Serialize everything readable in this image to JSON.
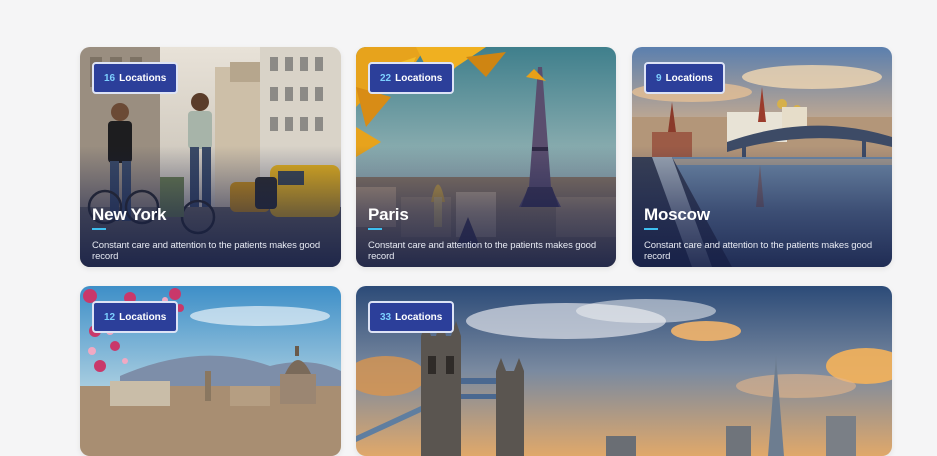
{
  "cards": [
    {
      "count": "16",
      "unit": "Locations",
      "city": "New York",
      "description": "Constant care and attention to the patients makes good record"
    },
    {
      "count": "22",
      "unit": "Locations",
      "city": "Paris",
      "description": "Constant care and attention to the patients makes good record"
    },
    {
      "count": "9",
      "unit": "Locations",
      "city": "Moscow",
      "description": "Constant care and attention to the patients makes good record"
    },
    {
      "count": "12",
      "unit": "Locations",
      "city": "",
      "description": ""
    },
    {
      "count": "33",
      "unit": "Locations",
      "city": "",
      "description": ""
    }
  ],
  "colors": {
    "badge_bg": "#2c3f9a",
    "badge_number": "#7dd0ff",
    "accent_underline": "#3ec0f0",
    "page_background": "#f5f5f6"
  }
}
